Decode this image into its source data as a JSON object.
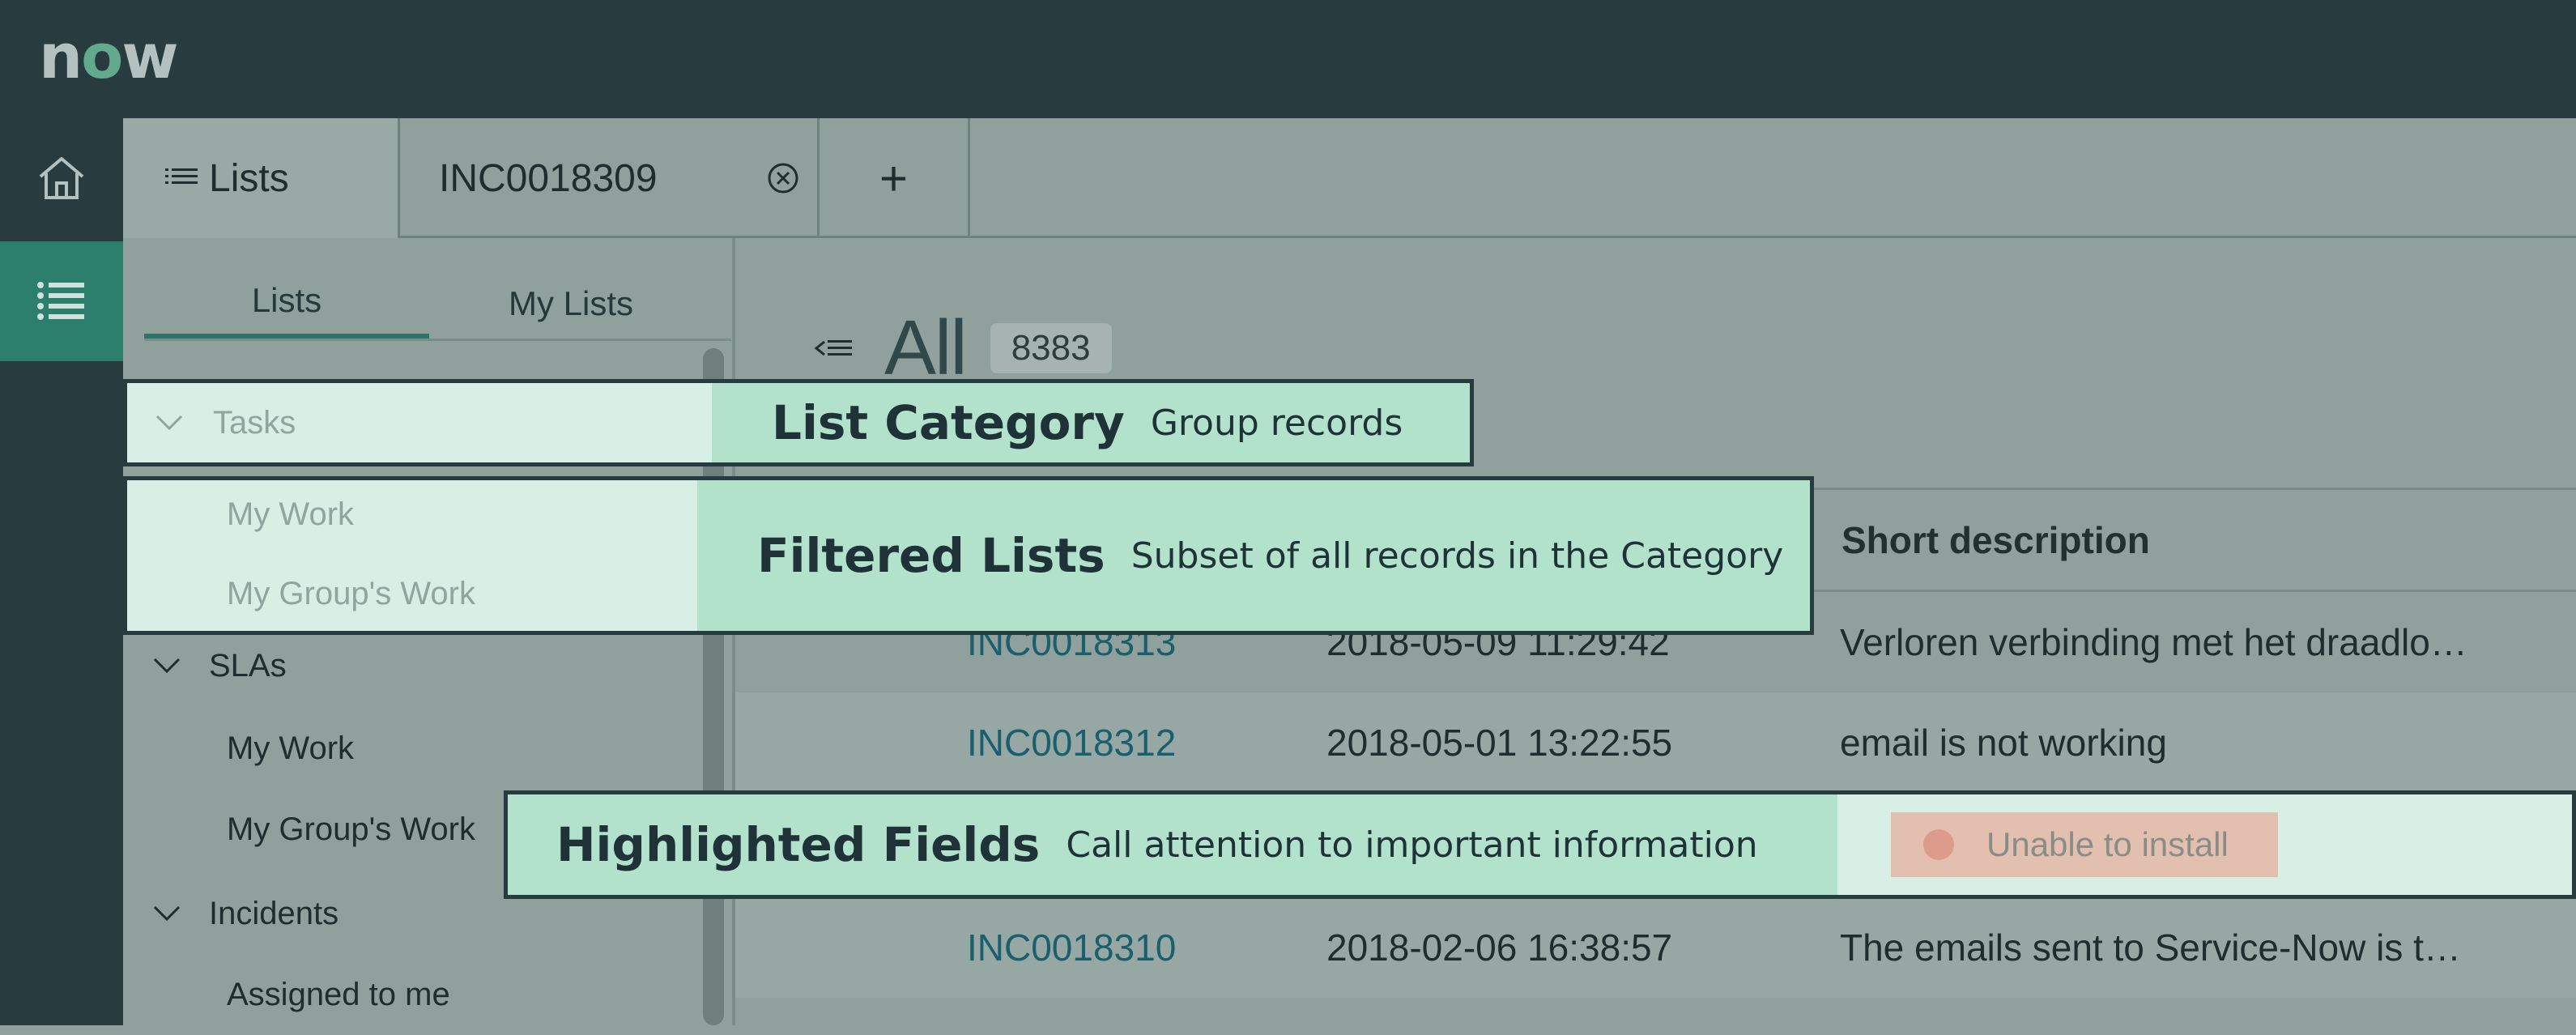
{
  "header": {
    "logo_text": "now"
  },
  "rail": [
    {
      "name": "home",
      "icon": "home-icon"
    },
    {
      "name": "lists",
      "icon": "list-icon",
      "active": true
    }
  ],
  "tabs": [
    {
      "label": "Lists",
      "icon": "list-icon"
    },
    {
      "label": "INC0018309",
      "close_icon": "close-circle-icon"
    },
    {
      "label": "+",
      "icon": "plus-icon"
    }
  ],
  "sidebar": {
    "subtabs": [
      "Lists",
      "My Lists"
    ],
    "active_subtab": "Lists",
    "groups": [
      {
        "label": "Tasks",
        "items": [
          "My Work",
          "My Group's Work"
        ]
      },
      {
        "label": "SLAs",
        "items": [
          "My Work",
          "My Group's Work"
        ]
      },
      {
        "label": "Incidents",
        "items": [
          "Assigned to me"
        ]
      }
    ]
  },
  "list": {
    "title": "All",
    "count": "8383",
    "columns": {
      "short_description": "Short description"
    },
    "rows": [
      {
        "number": "INC0018313",
        "date": "2018-05-09 11:29:42",
        "description": "Verloren verbinding met het draadlo…"
      },
      {
        "number": "INC0018312",
        "date": "2018-05-01 13:22:55",
        "description": "email is not working"
      },
      {
        "number": "",
        "date": "",
        "description": "Unable to install",
        "highlighted": true
      },
      {
        "number": "INC0018310",
        "date": "2018-02-06 16:38:57",
        "description": "The emails sent to Service-Now is t…"
      }
    ]
  },
  "callouts": {
    "category": {
      "title": "List Category",
      "desc": "Group records"
    },
    "filtered": {
      "title": "Filtered Lists",
      "desc": "Subset of all records in the Category"
    },
    "highlighted": {
      "title": "Highlighted Fields",
      "desc": "Call attention to important information"
    }
  },
  "colors": {
    "header_bg": "#283c40",
    "accent": "#2d7f6d",
    "callout_fill": "#b2e2cb",
    "callout_light": "#d7efe4",
    "highlight_pill": "#e3bfb0",
    "link": "#1a5f6e"
  }
}
